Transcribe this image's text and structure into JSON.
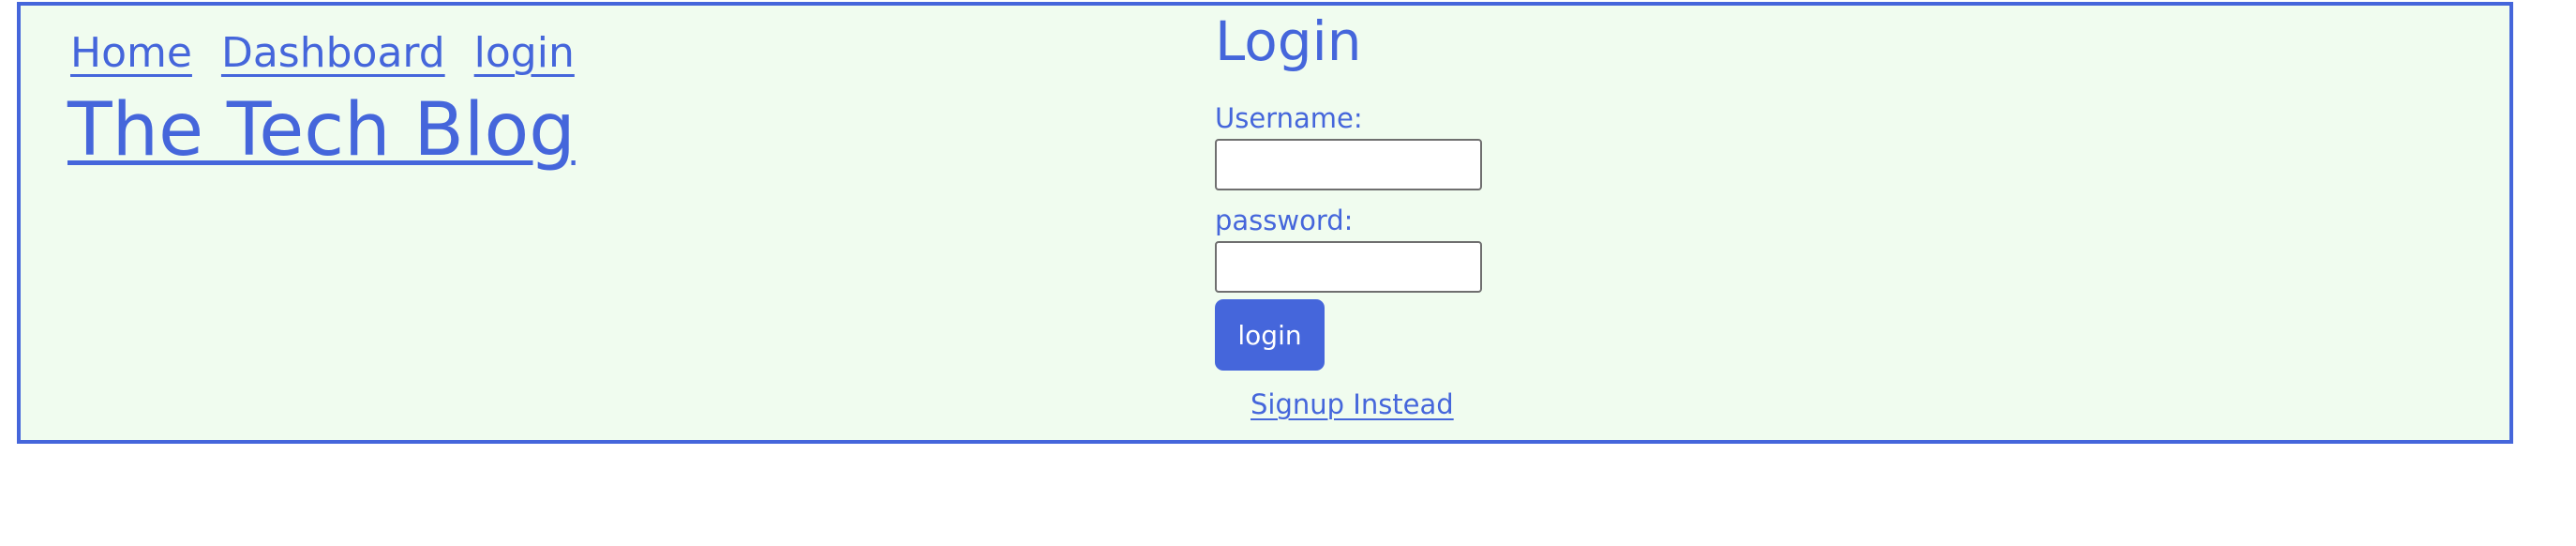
{
  "nav": {
    "items": [
      {
        "label": "Home"
      },
      {
        "label": "Dashboard"
      },
      {
        "label": "login"
      }
    ]
  },
  "brand": {
    "title": "The Tech Blog"
  },
  "login": {
    "title": "Login",
    "username_label": "Username:",
    "username_value": "",
    "password_label": "password:",
    "password_value": "",
    "submit_label": "login",
    "signup_link": "Signup Instead"
  },
  "colors": {
    "accent": "#4566db",
    "background": "#f0fcef",
    "input_border": "#6f6f6f"
  }
}
